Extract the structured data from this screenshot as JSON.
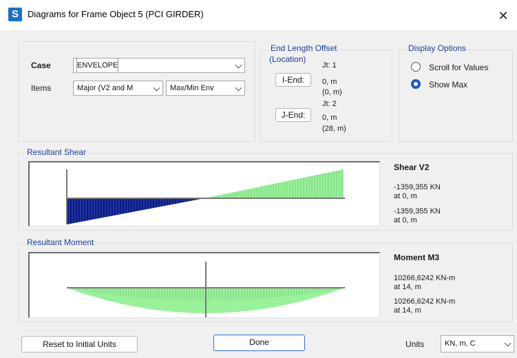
{
  "window": {
    "icon_letter": "S",
    "title": "Diagrams for Frame Object 5  (PCI GIRDER)",
    "close_glyph": "✕"
  },
  "case_panel": {
    "case_label": "Case",
    "case_value": "ENVELOPE",
    "items_label": "Items",
    "items_value": "Major (V2 and M",
    "items_mode": "Max/Min Env"
  },
  "end_offset": {
    "title_line1": "End Length Offset",
    "title_line2": "(Location)",
    "i_end_button": "I-End:",
    "i_jt": "Jt:  1",
    "i_length": "0, m",
    "i_location": "(0, m)",
    "j_end_button": "J-End:",
    "j_jt": "Jt:  2",
    "j_length": "0, m",
    "j_location": "(28, m)"
  },
  "display_options": {
    "title": "Display Options",
    "options": [
      {
        "label": "Scroll for Values",
        "selected": false
      },
      {
        "label": "Show Max",
        "selected": true
      }
    ]
  },
  "shear": {
    "group_title": "Resultant Shear",
    "heading": "Shear V2",
    "max_value": "-1359,355 KN",
    "max_at": "at 0, m",
    "min_value": "-1359,355 KN",
    "min_at": "at 0, m",
    "negative_color": "#0a1a82",
    "positive_color": "#98f29a"
  },
  "moment": {
    "group_title": "Resultant Moment",
    "heading": "Moment M3",
    "max_value": "10266,6242 KN-m",
    "max_at": "at 14, m",
    "min_value": "10266,6242 KN-m",
    "min_at": "at 14, m",
    "fill_color": "#98f29a"
  },
  "footer": {
    "reset_button": "Reset to Initial Units",
    "done_button": "Done",
    "units_label": "Units",
    "units_value": "KN, m, C"
  }
}
